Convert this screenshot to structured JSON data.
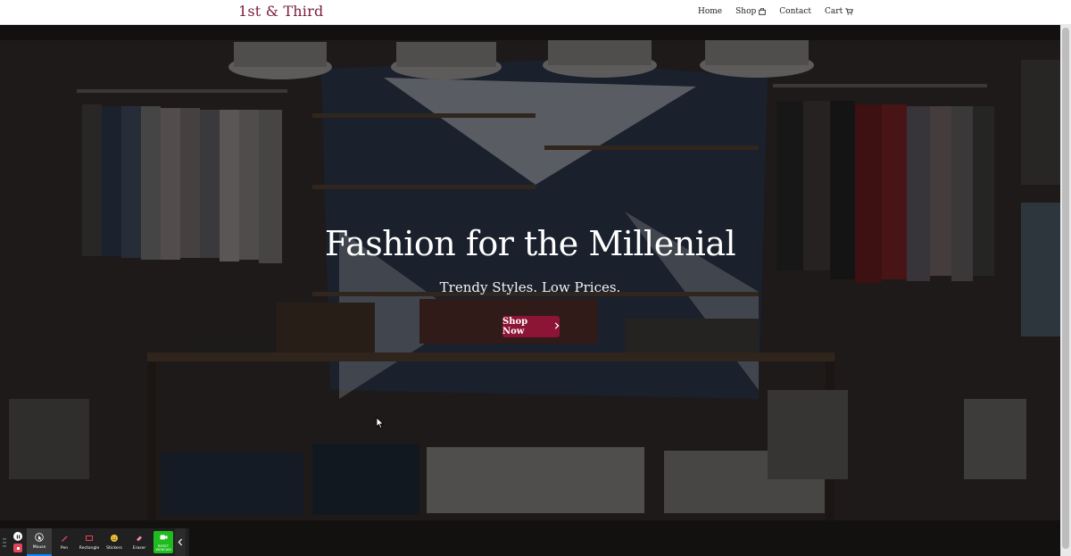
{
  "brand": {
    "name": "1st & Third",
    "color": "#7a1b3e"
  },
  "nav": {
    "items": [
      {
        "label": "Home",
        "icon": null
      },
      {
        "label": "Shop",
        "icon": "shopping-bag-icon"
      },
      {
        "label": "Contact",
        "icon": null
      },
      {
        "label": "Cart",
        "icon": "cart-icon"
      }
    ]
  },
  "hero": {
    "title": "Fashion for the Millenial",
    "subtitle": "Trendy Styles. Low Prices.",
    "cta_label": "Shop Now",
    "cta_icon": "chevron-right-icon",
    "cta_color": "#8c1435"
  },
  "recorder_toolbar": {
    "tools": [
      {
        "label": "Mouse",
        "icon": "mouse-pointer-icon",
        "active": true
      },
      {
        "label": "Pen",
        "icon": "pen-icon",
        "active": false
      },
      {
        "label": "Rectangle",
        "icon": "rectangle-icon",
        "active": false
      },
      {
        "label": "Stickers",
        "icon": "sticker-icon",
        "active": false
      },
      {
        "label": "Eraser",
        "icon": "eraser-icon",
        "active": false
      },
      {
        "label": "RESET WEBCAM",
        "icon": "webcam-icon",
        "active": false
      }
    ],
    "accent": "#1ebc1e"
  }
}
